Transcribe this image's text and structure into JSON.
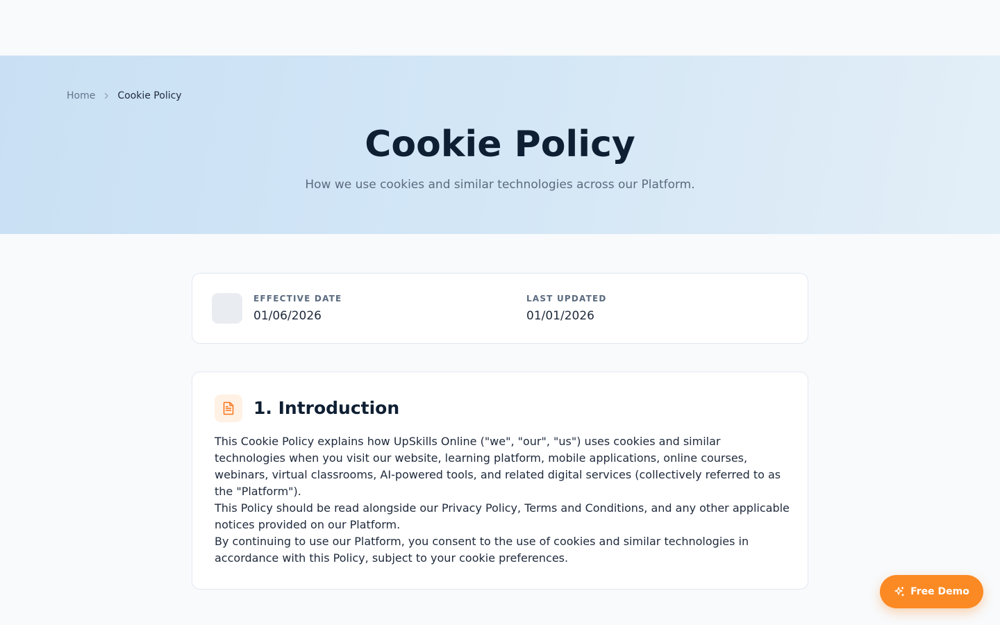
{
  "breadcrumb": {
    "home": "Home",
    "current": "Cookie Policy",
    "separator_icon": "chevron-right-icon"
  },
  "hero": {
    "title": "Cookie Policy",
    "subtitle": "How we use cookies and similar technologies across our Platform."
  },
  "meta": {
    "effective_label": "EFFECTIVE DATE",
    "effective_value": "01/06/2026",
    "updated_label": "LAST UPDATED",
    "updated_value": "01/01/2026"
  },
  "section": {
    "icon": "document-icon",
    "title": "1. Introduction",
    "paragraphs": [
      "This Cookie Policy explains how UpSkills Online (\"we\", \"our\", \"us\") uses cookies and similar technologies when you visit our website, learning platform, mobile applications, online courses, webinars, virtual classrooms, AI-powered tools, and related digital services (collectively referred to as the \"Platform\").",
      "This Policy should be read alongside our Privacy Policy, Terms and Conditions, and any other applicable notices provided on our Platform.",
      "By continuing to use our Platform, you consent to the use of cookies and similar technologies in accordance with this Policy, subject to your cookie preferences."
    ]
  },
  "cta": {
    "label": "Free Demo",
    "icon": "sparkle-icon"
  },
  "colors": {
    "accent": "#fb8a24",
    "title": "#0f1f33",
    "hero_bg": "#cfe4f5"
  }
}
